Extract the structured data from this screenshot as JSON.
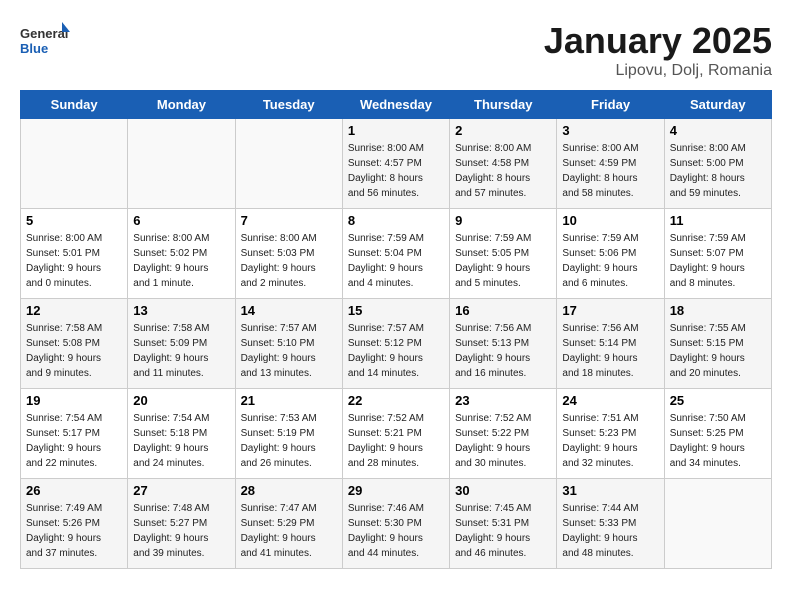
{
  "header": {
    "logo_general": "General",
    "logo_blue": "Blue",
    "month_title": "January 2025",
    "location": "Lipovu, Dolj, Romania"
  },
  "weekdays": [
    "Sunday",
    "Monday",
    "Tuesday",
    "Wednesday",
    "Thursday",
    "Friday",
    "Saturday"
  ],
  "weeks": [
    [
      {
        "day": "",
        "detail": ""
      },
      {
        "day": "",
        "detail": ""
      },
      {
        "day": "",
        "detail": ""
      },
      {
        "day": "1",
        "detail": "Sunrise: 8:00 AM\nSunset: 4:57 PM\nDaylight: 8 hours\nand 56 minutes."
      },
      {
        "day": "2",
        "detail": "Sunrise: 8:00 AM\nSunset: 4:58 PM\nDaylight: 8 hours\nand 57 minutes."
      },
      {
        "day": "3",
        "detail": "Sunrise: 8:00 AM\nSunset: 4:59 PM\nDaylight: 8 hours\nand 58 minutes."
      },
      {
        "day": "4",
        "detail": "Sunrise: 8:00 AM\nSunset: 5:00 PM\nDaylight: 8 hours\nand 59 minutes."
      }
    ],
    [
      {
        "day": "5",
        "detail": "Sunrise: 8:00 AM\nSunset: 5:01 PM\nDaylight: 9 hours\nand 0 minutes."
      },
      {
        "day": "6",
        "detail": "Sunrise: 8:00 AM\nSunset: 5:02 PM\nDaylight: 9 hours\nand 1 minute."
      },
      {
        "day": "7",
        "detail": "Sunrise: 8:00 AM\nSunset: 5:03 PM\nDaylight: 9 hours\nand 2 minutes."
      },
      {
        "day": "8",
        "detail": "Sunrise: 7:59 AM\nSunset: 5:04 PM\nDaylight: 9 hours\nand 4 minutes."
      },
      {
        "day": "9",
        "detail": "Sunrise: 7:59 AM\nSunset: 5:05 PM\nDaylight: 9 hours\nand 5 minutes."
      },
      {
        "day": "10",
        "detail": "Sunrise: 7:59 AM\nSunset: 5:06 PM\nDaylight: 9 hours\nand 6 minutes."
      },
      {
        "day": "11",
        "detail": "Sunrise: 7:59 AM\nSunset: 5:07 PM\nDaylight: 9 hours\nand 8 minutes."
      }
    ],
    [
      {
        "day": "12",
        "detail": "Sunrise: 7:58 AM\nSunset: 5:08 PM\nDaylight: 9 hours\nand 9 minutes."
      },
      {
        "day": "13",
        "detail": "Sunrise: 7:58 AM\nSunset: 5:09 PM\nDaylight: 9 hours\nand 11 minutes."
      },
      {
        "day": "14",
        "detail": "Sunrise: 7:57 AM\nSunset: 5:10 PM\nDaylight: 9 hours\nand 13 minutes."
      },
      {
        "day": "15",
        "detail": "Sunrise: 7:57 AM\nSunset: 5:12 PM\nDaylight: 9 hours\nand 14 minutes."
      },
      {
        "day": "16",
        "detail": "Sunrise: 7:56 AM\nSunset: 5:13 PM\nDaylight: 9 hours\nand 16 minutes."
      },
      {
        "day": "17",
        "detail": "Sunrise: 7:56 AM\nSunset: 5:14 PM\nDaylight: 9 hours\nand 18 minutes."
      },
      {
        "day": "18",
        "detail": "Sunrise: 7:55 AM\nSunset: 5:15 PM\nDaylight: 9 hours\nand 20 minutes."
      }
    ],
    [
      {
        "day": "19",
        "detail": "Sunrise: 7:54 AM\nSunset: 5:17 PM\nDaylight: 9 hours\nand 22 minutes."
      },
      {
        "day": "20",
        "detail": "Sunrise: 7:54 AM\nSunset: 5:18 PM\nDaylight: 9 hours\nand 24 minutes."
      },
      {
        "day": "21",
        "detail": "Sunrise: 7:53 AM\nSunset: 5:19 PM\nDaylight: 9 hours\nand 26 minutes."
      },
      {
        "day": "22",
        "detail": "Sunrise: 7:52 AM\nSunset: 5:21 PM\nDaylight: 9 hours\nand 28 minutes."
      },
      {
        "day": "23",
        "detail": "Sunrise: 7:52 AM\nSunset: 5:22 PM\nDaylight: 9 hours\nand 30 minutes."
      },
      {
        "day": "24",
        "detail": "Sunrise: 7:51 AM\nSunset: 5:23 PM\nDaylight: 9 hours\nand 32 minutes."
      },
      {
        "day": "25",
        "detail": "Sunrise: 7:50 AM\nSunset: 5:25 PM\nDaylight: 9 hours\nand 34 minutes."
      }
    ],
    [
      {
        "day": "26",
        "detail": "Sunrise: 7:49 AM\nSunset: 5:26 PM\nDaylight: 9 hours\nand 37 minutes."
      },
      {
        "day": "27",
        "detail": "Sunrise: 7:48 AM\nSunset: 5:27 PM\nDaylight: 9 hours\nand 39 minutes."
      },
      {
        "day": "28",
        "detail": "Sunrise: 7:47 AM\nSunset: 5:29 PM\nDaylight: 9 hours\nand 41 minutes."
      },
      {
        "day": "29",
        "detail": "Sunrise: 7:46 AM\nSunset: 5:30 PM\nDaylight: 9 hours\nand 44 minutes."
      },
      {
        "day": "30",
        "detail": "Sunrise: 7:45 AM\nSunset: 5:31 PM\nDaylight: 9 hours\nand 46 minutes."
      },
      {
        "day": "31",
        "detail": "Sunrise: 7:44 AM\nSunset: 5:33 PM\nDaylight: 9 hours\nand 48 minutes."
      },
      {
        "day": "",
        "detail": ""
      }
    ]
  ]
}
